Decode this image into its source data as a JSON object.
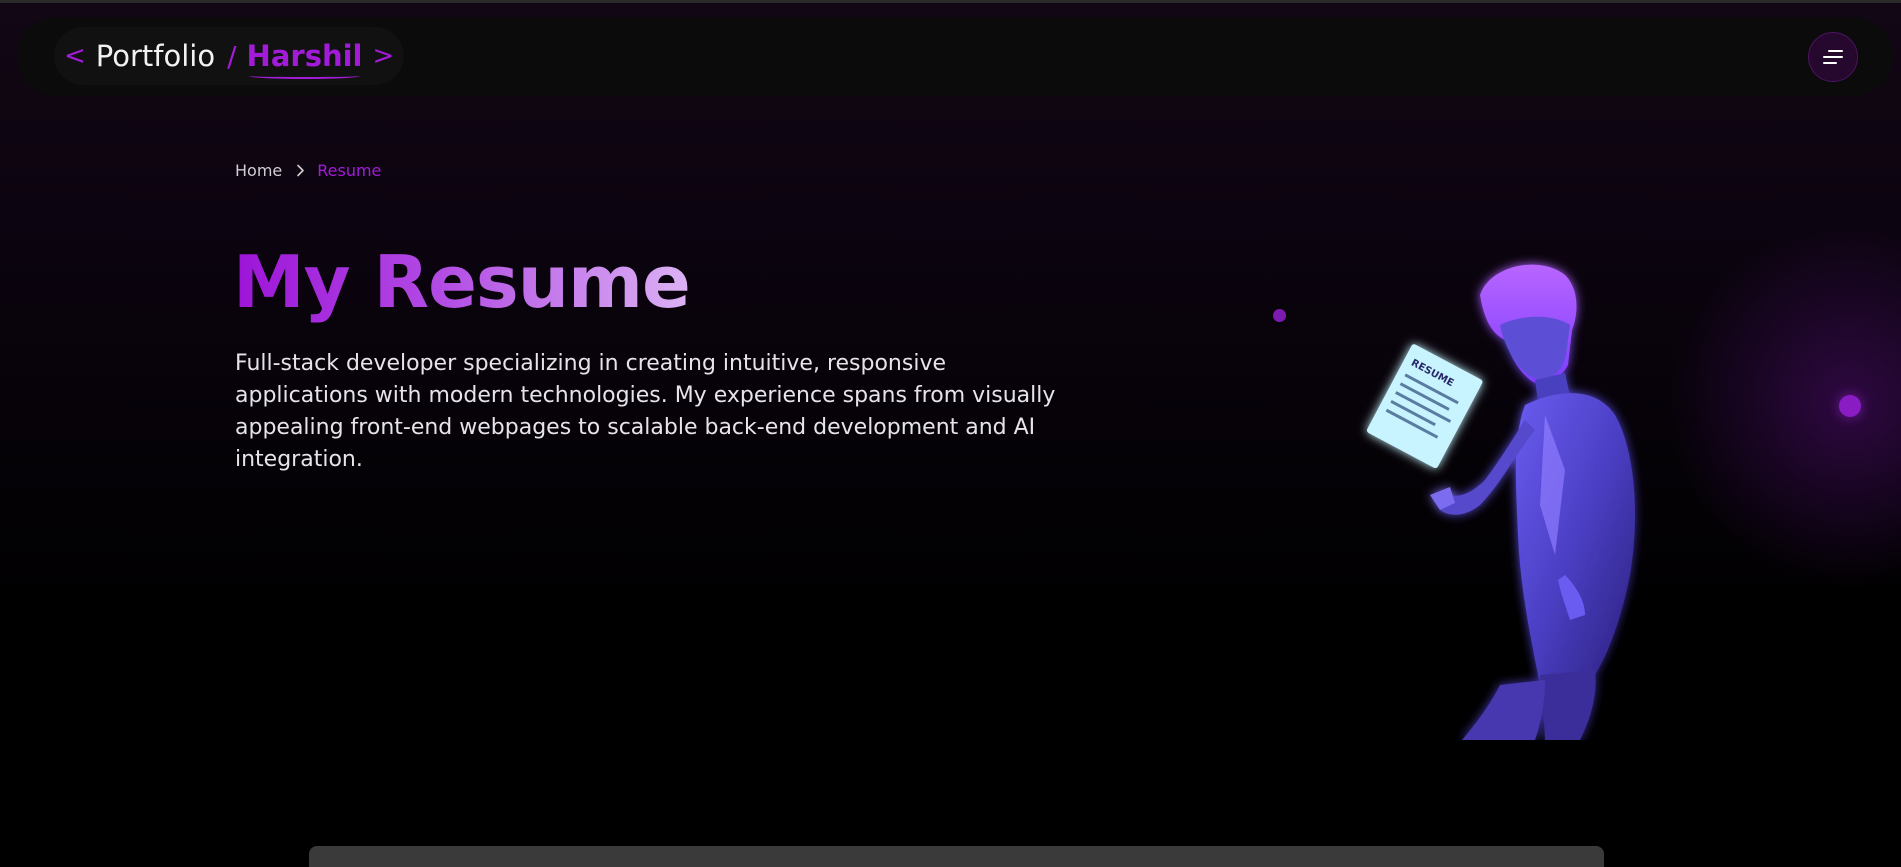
{
  "header": {
    "brand_left_chevron": "<",
    "brand_portfolio": "Portfolio",
    "brand_slash": "/",
    "brand_name": "Harshil",
    "brand_right_chevron": ">",
    "menu_icon": "hamburger-menu-icon"
  },
  "breadcrumb": {
    "home": "Home",
    "separator_icon": "chevron-right-icon",
    "current": "Resume"
  },
  "hero": {
    "title": "My Resume",
    "description": "Full-stack developer specializing in creating intuitive, responsive applications with modern technologies. My experience spans from visually appealing front-end webpages to scalable back-end development and AI integration.",
    "illustration_text": "RESUME"
  },
  "colors": {
    "accent": "#a21bd9",
    "background": "#000000",
    "header_bg": "#0b0b0b",
    "text": "#e6e3ea"
  }
}
